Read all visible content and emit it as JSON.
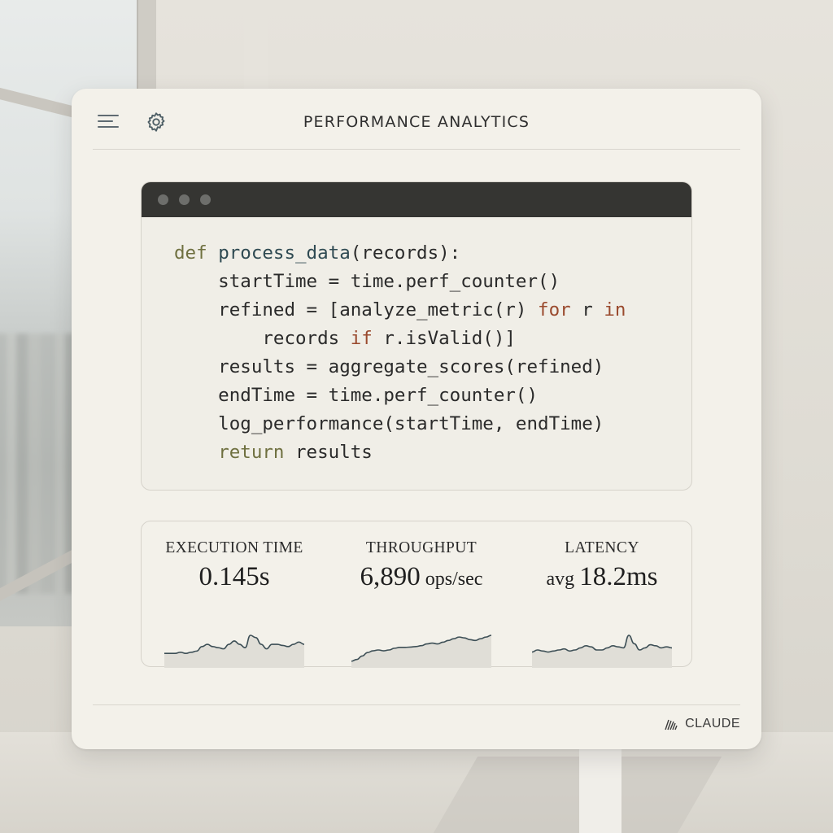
{
  "header": {
    "title": "PERFORMANCE ANALYTICS"
  },
  "icons": {
    "menu": "menu-icon",
    "settings": "gear-icon",
    "brand": "claude-logo-icon"
  },
  "code": {
    "lines": [
      [
        {
          "t": "def ",
          "c": "kw"
        },
        {
          "t": "process_data",
          "c": "fn"
        },
        {
          "t": "(records):",
          "c": ""
        }
      ],
      [
        {
          "t": "    startTime = time.perf_counter()",
          "c": ""
        }
      ],
      [
        {
          "t": "    refined = [analyze_metric(r) ",
          "c": ""
        },
        {
          "t": "for",
          "c": "kw2"
        },
        {
          "t": " r ",
          "c": ""
        },
        {
          "t": "in",
          "c": "kw2"
        }
      ],
      [
        {
          "t": "        records ",
          "c": ""
        },
        {
          "t": "if",
          "c": "kw2"
        },
        {
          "t": " r.isValid()]",
          "c": ""
        }
      ],
      [
        {
          "t": "    results = aggregate_scores(refined)",
          "c": ""
        }
      ],
      [
        {
          "t": "    endTime = time.perf_counter()",
          "c": ""
        }
      ],
      [
        {
          "t": "    log_performance(startTime, endTime)",
          "c": ""
        }
      ],
      [
        {
          "t": "    ",
          "c": ""
        },
        {
          "t": "return",
          "c": "kw"
        },
        {
          "t": " results",
          "c": ""
        }
      ]
    ]
  },
  "metrics": [
    {
      "label": "EXECUTION TIME",
      "prefix": "",
      "value": "0.145s",
      "suffix": "",
      "spark": [
        5,
        5,
        5,
        5.5,
        5,
        5.5,
        6,
        8,
        9,
        8,
        7.5,
        7,
        9,
        10.5,
        9,
        7.5,
        13,
        12,
        9,
        7,
        9,
        9,
        8.5,
        8,
        9,
        10,
        9
      ]
    },
    {
      "label": "THROUGHPUT",
      "prefix": "",
      "value": "6,890",
      "suffix": " ops/sec",
      "spark": [
        2,
        3,
        5,
        7,
        8,
        8.5,
        8,
        8.5,
        9.5,
        10,
        10,
        10.2,
        10.5,
        11,
        12,
        12.5,
        12,
        13,
        14,
        15,
        16,
        15.5,
        14.5,
        14,
        15,
        16,
        17
      ]
    },
    {
      "label": "LATENCY",
      "prefix": "avg ",
      "value": "18.2ms",
      "suffix": "",
      "spark": [
        6,
        7,
        6.5,
        6,
        6.5,
        7,
        7.5,
        6.5,
        7,
        8,
        9,
        8.5,
        7,
        7,
        8,
        9,
        8.5,
        8,
        14,
        10,
        7,
        8,
        9.5,
        9,
        8,
        8.5,
        8
      ]
    }
  ],
  "footer": {
    "brand": "CLAUDE"
  },
  "colors": {
    "accent": "#2f4a52",
    "spark_line": "#3d4f56",
    "spark_fill": "#e0ded7"
  }
}
